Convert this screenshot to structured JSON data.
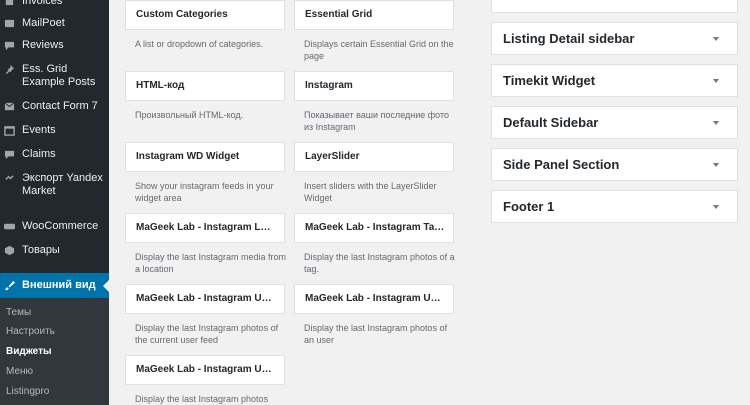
{
  "sidebar": {
    "items": [
      {
        "label": "Invoices",
        "icon": "invoice-icon"
      },
      {
        "label": "MailPoet",
        "icon": "mail-icon"
      },
      {
        "label": "Reviews",
        "icon": "comment-icon"
      },
      {
        "label": "Ess. Grid Example Posts",
        "icon": "pin-icon"
      },
      {
        "label": "Contact Form 7",
        "icon": "envelope-icon"
      },
      {
        "label": "Events",
        "icon": "calendar-icon"
      },
      {
        "label": "Claims",
        "icon": "comment-icon"
      },
      {
        "label": "Экспорт Yandex Market",
        "icon": "export-icon"
      },
      {
        "label": "WooCommerce",
        "icon": "woocommerce-icon"
      },
      {
        "label": "Товары",
        "icon": "box-icon"
      },
      {
        "label": "Внешний вид",
        "icon": "brush-icon"
      }
    ],
    "submenu": [
      {
        "label": "Темы"
      },
      {
        "label": "Настроить"
      },
      {
        "label": "Виджеты"
      },
      {
        "label": "Меню"
      },
      {
        "label": "Listingpro"
      }
    ]
  },
  "widgets": {
    "left": [
      {
        "title": "Custom Categories",
        "desc": "A list or dropdown of categories."
      },
      {
        "title": "HTML-код",
        "desc": "Произвольный HTML-код."
      },
      {
        "title": "Instagram WD Widget",
        "desc": "Show your instagram feeds in your widget area"
      },
      {
        "title": "MaGeek Lab - Instagram Loc…",
        "desc": "Display the last Instagram media from a location"
      },
      {
        "title": "MaGeek Lab - Instagram Use…",
        "desc": "Display the last Instagram photos of the current user feed"
      },
      {
        "title": "MaGeek Lab - Instagram Use…",
        "desc": "Display the last Instagram photos"
      }
    ],
    "right": [
      {
        "title": "Essential Grid",
        "desc": "Displays certain Essential Grid on the page"
      },
      {
        "title": "Instagram",
        "desc": "Показывает ваши последние фото из Instagram"
      },
      {
        "title": "LayerSlider",
        "desc": "Insert sliders with the LayerSlider Widget"
      },
      {
        "title": "MaGeek Lab - Instagram Tag …",
        "desc": "Display the last Instagram photos of a tag."
      },
      {
        "title": "MaGeek Lab - Instagram Use…",
        "desc": "Display the last Instagram photos of an user"
      }
    ]
  },
  "widget_areas": [
    {
      "title": "Listing Detail sidebar"
    },
    {
      "title": "Timekit Widget"
    },
    {
      "title": "Default Sidebar"
    },
    {
      "title": "Side Panel Section"
    },
    {
      "title": "Footer 1"
    }
  ],
  "colors": {
    "sidebar_bg": "#23282d",
    "active_bg": "#0073aa",
    "page_bg": "#f1f1f1"
  }
}
